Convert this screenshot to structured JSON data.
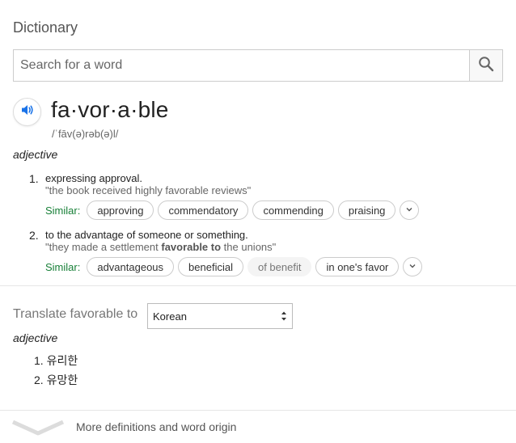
{
  "header": {
    "title": "Dictionary"
  },
  "search": {
    "placeholder": "Search for a word",
    "value": ""
  },
  "entry": {
    "headword": "fa·vor·a·ble",
    "phonetic": "/ˈfāv(ə)rəb(ə)l/",
    "part_of_speech": "adjective",
    "senses": [
      {
        "number": "1.",
        "definition": "expressing approval.",
        "example": "\"the book received highly favorable reviews\"",
        "similar_label": "Similar:",
        "similar": [
          "approving",
          "commendatory",
          "commending",
          "praising"
        ]
      },
      {
        "number": "2.",
        "definition": "to the advantage of someone or something.",
        "example_before": "\"they made a settlement ",
        "example_bold": "favorable to",
        "example_after": " the unions\"",
        "similar_label": "Similar:",
        "similar": [
          "advantageous",
          "beneficial",
          "of benefit",
          "in one's favor"
        ]
      }
    ]
  },
  "translate": {
    "label": "Translate favorable to",
    "language": "Korean",
    "part_of_speech": "adjective",
    "items": [
      {
        "number": "1.",
        "text": "유리한"
      },
      {
        "number": "2.",
        "text": "유망한"
      }
    ]
  },
  "footer": {
    "more_label": "More definitions and word origin"
  },
  "icons": {
    "search": "search-icon",
    "speaker": "speaker-icon",
    "chevron": "chevron-down-icon",
    "select": "select-arrows-icon"
  },
  "colors": {
    "similar_label": "#188038",
    "speaker_accent": "#1a73e8"
  }
}
